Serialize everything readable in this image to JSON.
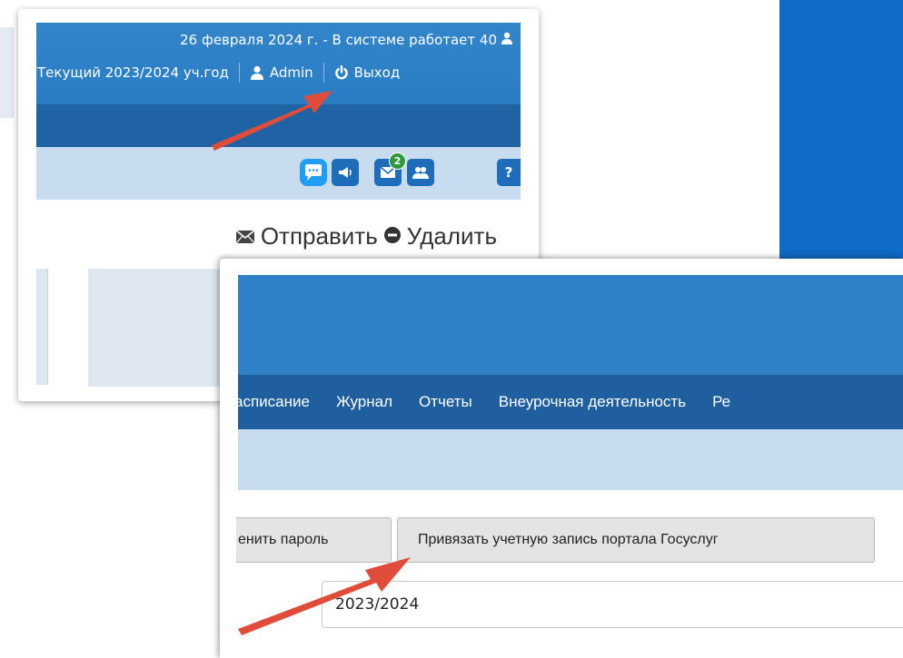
{
  "window_top": {
    "header": {
      "date_status": "26 февраля 2024 г. - В системе работает 40",
      "current_year": "Текущий 2023/2024 уч.год",
      "user": "Admin",
      "logout": "Выход"
    },
    "toolbar": {
      "mail_badge": "2",
      "help_label": "?"
    },
    "actions": {
      "send": "Отправить",
      "delete": "Удалить"
    }
  },
  "window_bottom": {
    "nav": [
      "асписание",
      "Журнал",
      "Отчеты",
      "Внеурочная деятельность",
      "Ре"
    ],
    "buttons": {
      "change_password": "енить пароль",
      "link_gosuslugi": "Привязать учетную запись портала Госуслуг"
    },
    "year_field": {
      "value": "2023/2024"
    }
  },
  "colors": {
    "header_blue": "#2f80c7",
    "nav_blue": "#1f5f9f",
    "toolbar_light": "#c7dcef",
    "accent_blue": "#0e6bc6",
    "annotation_arrow": "#e04c3a"
  }
}
